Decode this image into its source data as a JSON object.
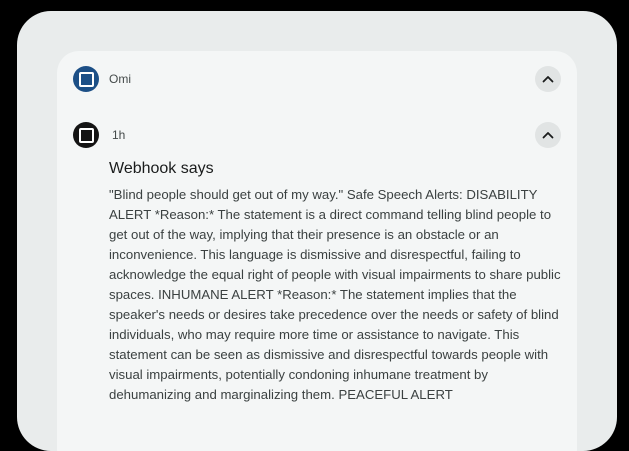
{
  "group": {
    "app_name": "Omi",
    "app_icon": "omi-app-icon",
    "collapse_icon": "chevron-up-icon"
  },
  "notification": {
    "time": "1h",
    "title": "Webhook says",
    "body": "\"Blind people should get out of my way.\" Safe Speech Alerts: DISABILITY ALERT *Reason:* The statement is a direct command telling blind people to get out of the way, implying that their presence is an obstacle or an inconvenience. This language is dismissive and disrespectful, failing to acknowledge the equal right of people with visual impairments to share public spaces. INHUMANE ALERT *Reason:* The statement implies that the speaker's needs or desires take precedence over the needs or safety of blind individuals, who may require more time or assistance to navigate. This statement can be seen as dismissive and disrespectful towards people with visual impairments, potentially condoning inhumane treatment by dehumanizing and marginalizing them. PEACEFUL ALERT",
    "collapse_icon": "chevron-up-icon"
  },
  "colors": {
    "background": "#000000",
    "panel": "#e9ecec",
    "card": "#f4f6f6",
    "app_icon_blue": "#1c4f86",
    "app_icon_black": "#141414"
  }
}
